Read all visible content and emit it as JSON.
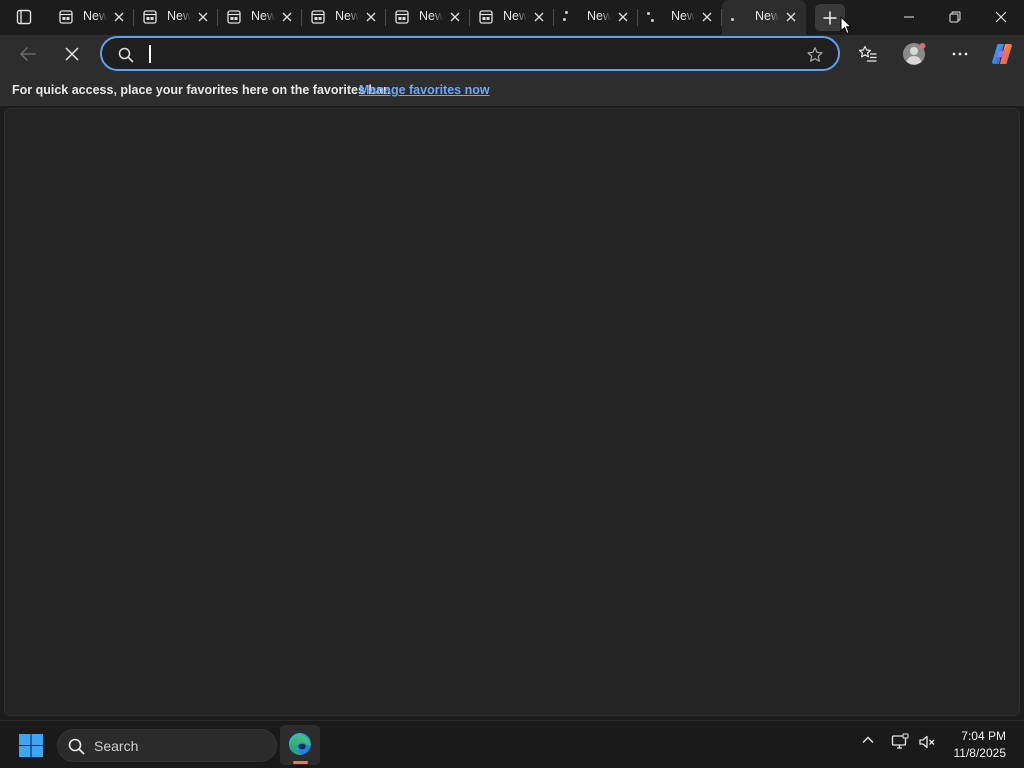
{
  "window": {
    "tabs": [
      {
        "title": "New tab",
        "favicon": "tab-page-icon",
        "active": false
      },
      {
        "title": "New tab",
        "favicon": "tab-page-icon",
        "active": false
      },
      {
        "title": "New tab",
        "favicon": "tab-page-icon",
        "active": false
      },
      {
        "title": "New tab",
        "favicon": "tab-page-icon",
        "active": false
      },
      {
        "title": "New tab",
        "favicon": "tab-page-icon",
        "active": false
      },
      {
        "title": "New tab",
        "favicon": "tab-page-icon",
        "active": false
      },
      {
        "title": "New tab",
        "favicon": "loading-dots-icon",
        "active": false
      },
      {
        "title": "New tab",
        "favicon": "loading-dots-icon",
        "active": false
      },
      {
        "title": "New tab",
        "favicon": "loading-dots-icon",
        "active": true
      }
    ],
    "new_tab_icon": "plus-icon",
    "controls": [
      "minimize-icon",
      "restore-icon",
      "close-icon"
    ]
  },
  "toolbar": {
    "back_icon": "back-arrow-icon",
    "stop_icon": "stop-loading-icon",
    "address": {
      "value": "",
      "placeholder": ""
    },
    "icons": [
      "search-icon",
      "favorite-star-icon",
      "favorites-icon",
      "profile-icon",
      "more-icon",
      "copilot-icon"
    ]
  },
  "favorites_bar": {
    "message": "For quick access, place your favorites here on the favorites bar.",
    "link": "Manage favorites now"
  },
  "taskbar": {
    "search_label": "Search",
    "time": "7:04 PM",
    "date": "11/8/2025"
  },
  "colors": {
    "accent": "#5fa0ef",
    "link": "#6fa8f5",
    "background": "#1c1c1c",
    "toolbar": "#2d2d2d",
    "content": "#242424",
    "taskbar_indicator": "#f1784e"
  }
}
